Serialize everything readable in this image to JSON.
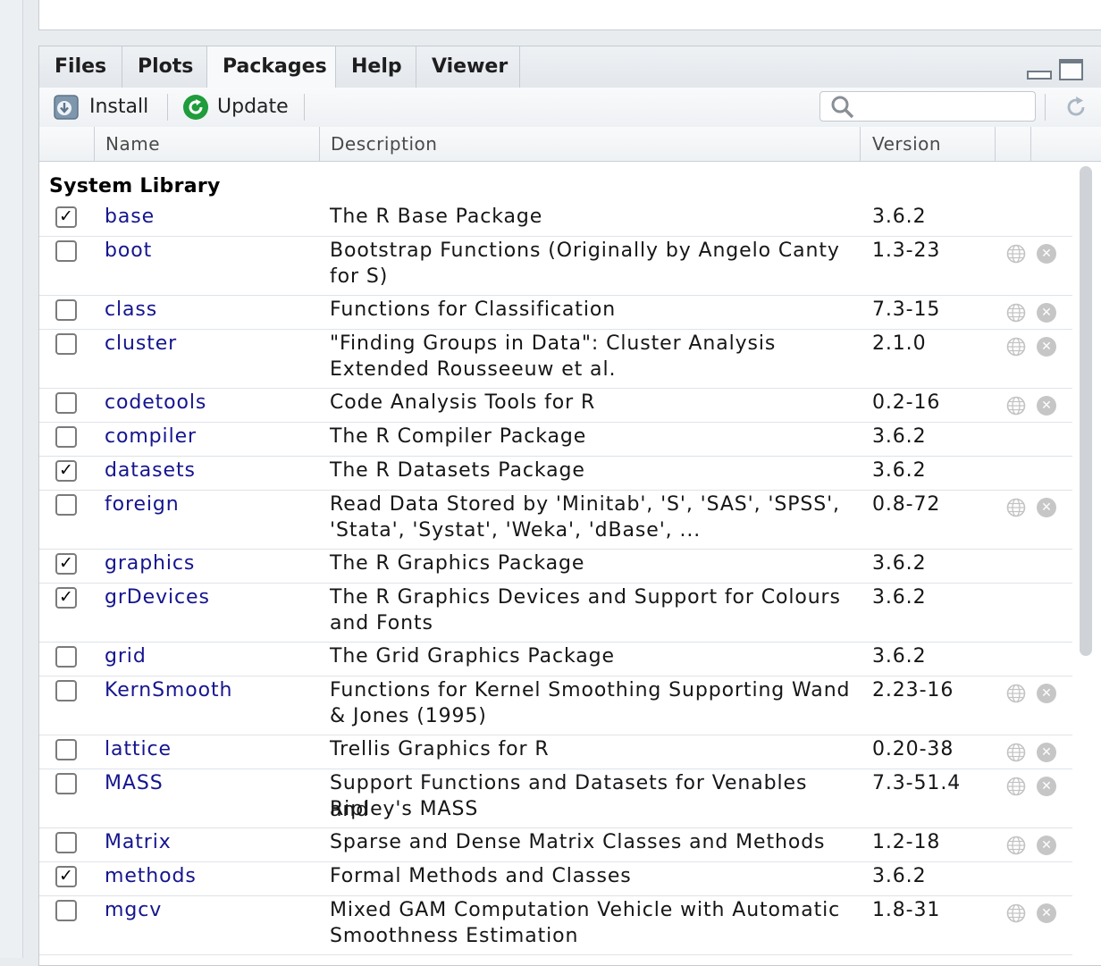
{
  "tabs": [
    "Files",
    "Plots",
    "Packages",
    "Help",
    "Viewer"
  ],
  "active_tab": "Packages",
  "toolbar": {
    "install_label": "Install",
    "update_label": "Update",
    "search_placeholder": "",
    "install_icon": "install-arrow-icon",
    "update_icon": "update-refresh-icon",
    "refresh_icon": "refresh-icon"
  },
  "columns": {
    "name": "Name",
    "description": "Description",
    "version": "Version"
  },
  "section_title": "System Library",
  "colors": {
    "name_link": "#15158f",
    "update_green": "#1f9c3b"
  },
  "packages": [
    {
      "checked": true,
      "name": "base",
      "desc": "The R Base Package",
      "desc2": "",
      "version": "3.6.2",
      "actions": false
    },
    {
      "checked": false,
      "name": "boot",
      "desc": "Bootstrap Functions (Originally by Angelo Canty",
      "desc2": "for S)",
      "version": "1.3-23",
      "actions": true
    },
    {
      "checked": false,
      "name": "class",
      "desc": "Functions for Classification",
      "desc2": "",
      "version": "7.3-15",
      "actions": true
    },
    {
      "checked": false,
      "name": "cluster",
      "desc": "\"Finding Groups in Data\": Cluster Analysis",
      "desc2": "Extended Rousseeuw et al.",
      "version": "2.1.0",
      "actions": true
    },
    {
      "checked": false,
      "name": "codetools",
      "desc": "Code Analysis Tools for R",
      "desc2": "",
      "version": "0.2-16",
      "actions": true
    },
    {
      "checked": false,
      "name": "compiler",
      "desc": "The R Compiler Package",
      "desc2": "",
      "version": "3.6.2",
      "actions": false
    },
    {
      "checked": true,
      "name": "datasets",
      "desc": "The R Datasets Package",
      "desc2": "",
      "version": "3.6.2",
      "actions": false
    },
    {
      "checked": false,
      "name": "foreign",
      "desc": "Read Data Stored by 'Minitab', 'S', 'SAS', 'SPSS',",
      "desc2": "'Stata', 'Systat', 'Weka', 'dBase', ...",
      "version": "0.8-72",
      "actions": true
    },
    {
      "checked": true,
      "name": "graphics",
      "desc": "The R Graphics Package",
      "desc2": "",
      "version": "3.6.2",
      "actions": false
    },
    {
      "checked": true,
      "name": "grDevices",
      "desc": "The R Graphics Devices and Support for Colours",
      "desc2": "and Fonts",
      "version": "3.6.2",
      "actions": false
    },
    {
      "checked": false,
      "name": "grid",
      "desc": "The Grid Graphics Package",
      "desc2": "",
      "version": "3.6.2",
      "actions": false
    },
    {
      "checked": false,
      "name": "KernSmooth",
      "desc": "Functions for Kernel Smoothing Supporting Wand",
      "desc2": "& Jones (1995)",
      "version": "2.23-16",
      "actions": true
    },
    {
      "checked": false,
      "name": "lattice",
      "desc": "Trellis Graphics for R",
      "desc2": "",
      "version": "0.20-38",
      "actions": true
    },
    {
      "checked": false,
      "name": "MASS",
      "desc": "Support Functions and Datasets for Venables and",
      "desc2": "Ripley's MASS",
      "version": "7.3-51.4",
      "actions": true
    },
    {
      "checked": false,
      "name": "Matrix",
      "desc": "Sparse and Dense Matrix Classes and Methods",
      "desc2": "",
      "version": "1.2-18",
      "actions": true
    },
    {
      "checked": true,
      "name": "methods",
      "desc": "Formal Methods and Classes",
      "desc2": "",
      "version": "3.6.2",
      "actions": false
    },
    {
      "checked": false,
      "name": "mgcv",
      "desc": "Mixed GAM Computation Vehicle with Automatic",
      "desc2": "Smoothness Estimation",
      "version": "1.8-31",
      "actions": true
    }
  ]
}
